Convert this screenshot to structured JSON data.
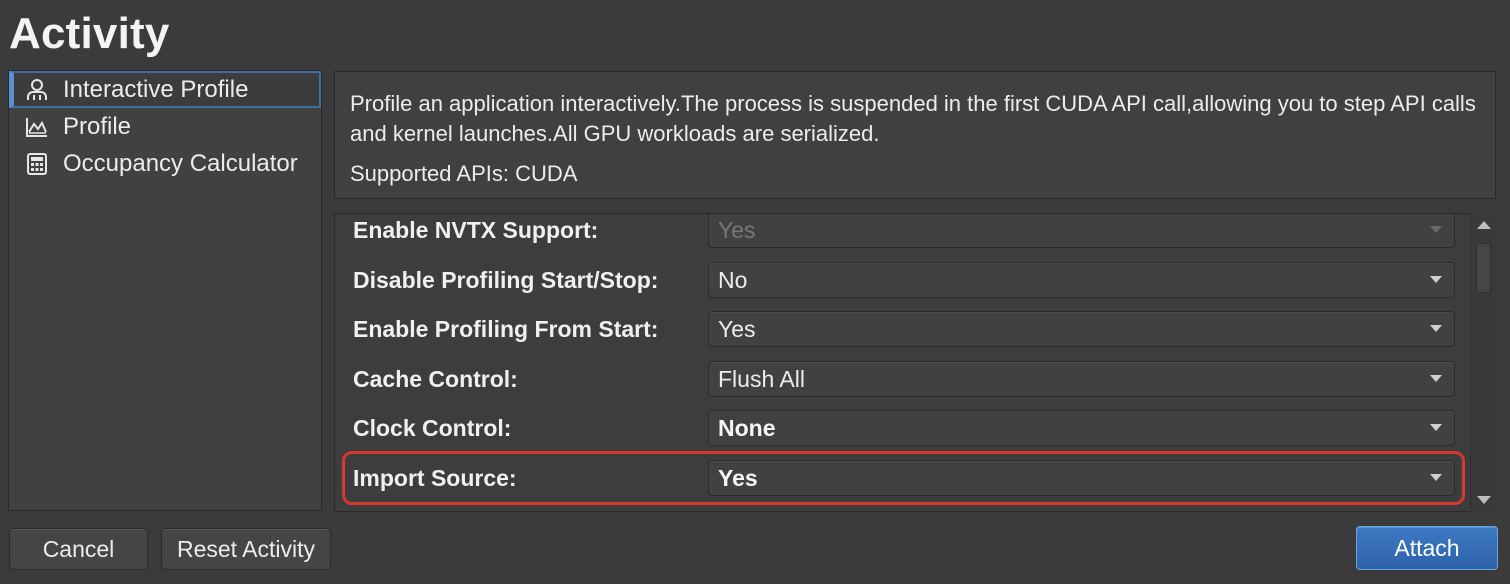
{
  "title": "Activity",
  "sidebar": {
    "items": [
      {
        "label": "Interactive Profile",
        "icon": "person-icon",
        "selected": true
      },
      {
        "label": "Profile",
        "icon": "chart-icon",
        "selected": false
      },
      {
        "label": "Occupancy Calculator",
        "icon": "calculator-icon",
        "selected": false
      }
    ]
  },
  "description": {
    "text": "Profile an application interactively.The process is suspended in the first CUDA API call,allowing you to step API calls and kernel launches.All GPU workloads are serialized.",
    "apis": "Supported APIs: CUDA"
  },
  "settings": {
    "rows": [
      {
        "label": "Enable NVTX Support:",
        "value": "Yes",
        "disabled": true
      },
      {
        "label": "Disable Profiling Start/Stop:",
        "value": "No"
      },
      {
        "label": "Enable Profiling From Start:",
        "value": "Yes"
      },
      {
        "label": "Cache Control:",
        "value": "Flush All"
      },
      {
        "label": "Clock Control:",
        "value": "None",
        "bold": true
      },
      {
        "label": "Import Source:",
        "value": "Yes",
        "bold": true,
        "highlighted": true
      }
    ]
  },
  "buttons": {
    "cancel": "Cancel",
    "reset": "Reset Activity",
    "attach": "Attach"
  },
  "colors": {
    "background": "#3b3b3b",
    "accent": "#3e79c4",
    "highlight": "#d8392e"
  }
}
